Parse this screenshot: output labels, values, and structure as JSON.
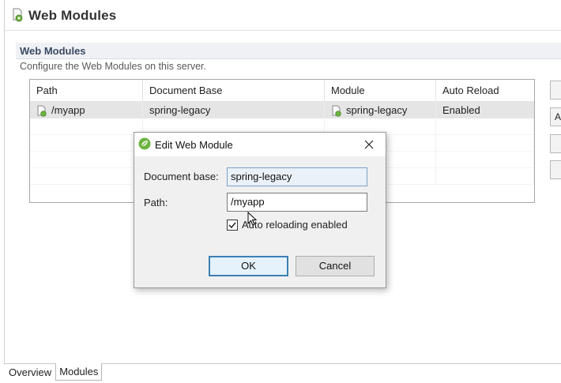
{
  "editor": {
    "title": "Web Modules",
    "section_title": "Web Modules",
    "section_description": "Configure the Web Modules on this server.",
    "icon": "server-module-icon"
  },
  "table": {
    "columns": [
      "Path",
      "Document Base",
      "Module",
      "Auto Reload"
    ],
    "rows": [
      {
        "path": "/myapp",
        "document_base": "spring-legacy",
        "module": "spring-legacy",
        "auto_reload": "Enabled"
      }
    ]
  },
  "side_buttons": [
    "",
    "A",
    "",
    ""
  ],
  "bottom_tabs": [
    "Overview",
    "Modules"
  ],
  "dialog": {
    "title": "Edit Web Module",
    "icon": "spring-leaf-icon",
    "document_base_label": "Document base:",
    "document_base_value": "spring-legacy",
    "path_label": "Path:",
    "path_value": "/myapp",
    "auto_reload_label": "Auto reloading enabled",
    "auto_reload_checked": true,
    "ok_label": "OK",
    "cancel_label": "Cancel"
  },
  "colors": {
    "accent": "#3c7fb1",
    "selected_row": "#e5e5e5",
    "section_bar": "#eff1f5",
    "spring_green": "#6db33f"
  }
}
